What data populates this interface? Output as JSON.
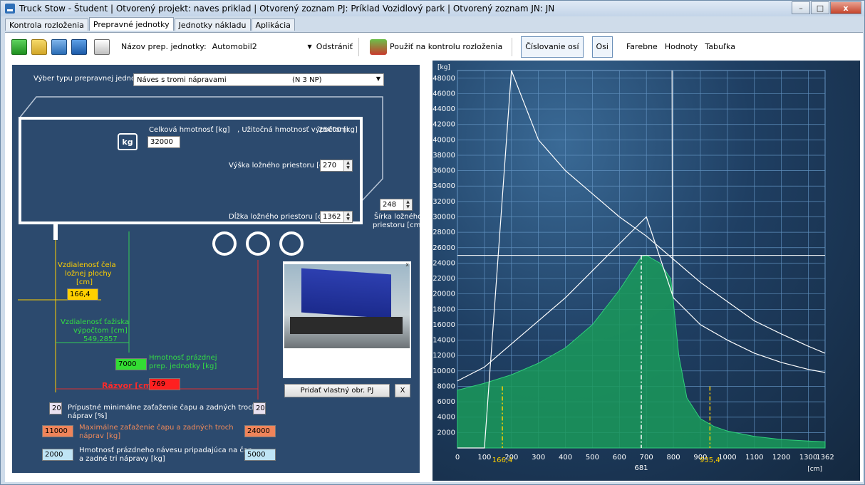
{
  "window": {
    "title": "Truck Stow - Študent  |  Otvorený projekt: naves priklad  |  Otvorený zoznam PJ: Príklad Vozidlový park  |  Otvorený zoznam JN: JN",
    "minimize": "–",
    "maximize": "□",
    "close": "x"
  },
  "tabs": [
    {
      "label": "Kontrola rozloženia",
      "active": false
    },
    {
      "label": "Prepravné jednotky",
      "active": true
    },
    {
      "label": "Jednotky nákladu",
      "active": false
    },
    {
      "label": "Aplikácia",
      "active": false
    }
  ],
  "toolbar": {
    "icons": [
      "new-icon",
      "open-folder-icon",
      "copy-icon",
      "save-icon",
      "print-icon"
    ],
    "unit_name_label": "Názov prep. jednotky:",
    "unit_name_value": "Automobil2",
    "remove_label": "Odstrániť",
    "apply_label": "Použiť na kontrolu rozloženia",
    "axle_numbering_label": "Číslovanie osí",
    "axles_label": "Osi",
    "colored_label": "Farebne",
    "values_label": "Hodnoty",
    "table_label": "Tabuľka"
  },
  "left": {
    "type_label": "Výber typu prepravnej jednotky",
    "type_value": "Náves s tromi nápravami",
    "type_code": "(N 3 NP)",
    "total_weight_label": "Celková hmotnosť [kg]",
    "payload_label": ", Užitočná hmotnosť výpočtom:",
    "payload_value": "25000 [kg]",
    "total_weight_value": "32000",
    "kg_icon_text": "kg",
    "height_label": "Výška ložného priestoru [cm]",
    "height_value": "270",
    "length_label": "Dĺžka ložného priestoru [cm]",
    "length_value": "1362",
    "width_value": "248",
    "width_label_1": "Šírka ložného",
    "width_label_2": "priestoru [cm]",
    "front_dist_label_1": "Vzdialenosť čela",
    "front_dist_label_2": "ložnej plochy",
    "front_dist_label_3": "[cm]",
    "front_dist_value": "166,4",
    "cog_label_1": "Vzdialenosť ťažiska",
    "cog_label_2": "výpočtom [cm]",
    "cog_value": "549,2857",
    "empty_weight_value": "7000",
    "empty_weight_label_1": "Hmotnosť prázdnej",
    "empty_weight_label_2": "prep. jednotky [kg]",
    "spacing_label": "Rázvor [cm]",
    "spacing_value": "769",
    "min_pct_left": "20",
    "min_pct_right": "20",
    "min_load_label_1": "Prípustné minimálne zaťaženie čapu a zadných troch",
    "min_load_label_2": "náprav [%]",
    "max_left": "11000",
    "max_right": "24000",
    "max_label_1": "Maximálne zaťaženie čapu a zadných troch",
    "max_label_2": "náprav [kg]",
    "empty_left": "2000",
    "empty_right": "5000",
    "empty_label_1": "Hmotnosť prázdneho návesu pripadajúca na čap",
    "empty_label_2": "a zadné tri nápravy [kg]",
    "add_image_label": "Pridať vlastný obr. PJ",
    "remove_image_label": "X",
    "photo_close": "x"
  },
  "colors": {
    "panel_bg": "#2c4a6e",
    "fill_green": "#1a9a5a",
    "yellow": "#ffd000",
    "green_field": "#33dd33",
    "red_field": "#ff2020",
    "orange_field": "#f0845a",
    "blue_field": "#bfe4f5"
  },
  "chart_data": {
    "type": "area",
    "ylabel": "[kg]",
    "xlabel": "[cm]",
    "xlim": [
      0,
      1362
    ],
    "ylim": [
      0,
      49000
    ],
    "x_ticks": [
      0,
      100,
      200,
      300,
      400,
      500,
      600,
      700,
      800,
      900,
      1000,
      1100,
      1200,
      1300,
      1362
    ],
    "y_ticks": [
      2000,
      4000,
      6000,
      8000,
      10000,
      12000,
      14000,
      16000,
      18000,
      20000,
      22000,
      24000,
      26000,
      28000,
      30000,
      32000,
      34000,
      36000,
      38000,
      40000,
      42000,
      44000,
      46000,
      48000
    ],
    "vertical_markers": [
      166.4,
      681,
      935.4
    ],
    "vertical_marker_labels": [
      "166,4",
      "681",
      "935,4"
    ],
    "horizontal_line": 25000,
    "grid": true,
    "series": [
      {
        "x": [
          0,
          100,
          200,
          300,
          400,
          500,
          600,
          681,
          700,
          750,
          790,
          800,
          820,
          850,
          900,
          950,
          1000,
          1100,
          1200,
          1300,
          1362
        ],
        "y": [
          7500,
          8400,
          9500,
          11000,
          13000,
          16000,
          20500,
          24800,
          25000,
          24000,
          22000,
          19000,
          12000,
          6500,
          3800,
          2800,
          2200,
          1500,
          1100,
          900,
          800
        ]
      }
    ],
    "curves": [
      {
        "x": [
          0,
          100,
          200,
          300,
          400,
          500,
          600,
          700,
          800,
          900,
          1000,
          1100,
          1200,
          1300,
          1362
        ],
        "y": [
          8700,
          10500,
          13500,
          16500,
          19500,
          23000,
          26500,
          30000,
          19500,
          16000,
          14000,
          12300,
          11100,
          10200,
          9800
        ]
      },
      {
        "x": [
          0,
          100,
          200,
          300,
          400,
          500,
          600,
          700,
          800,
          900,
          1000,
          1100,
          1200,
          1300,
          1362
        ],
        "y": [
          0,
          0,
          49000,
          40000,
          36000,
          33000,
          30000,
          27500,
          24500,
          21500,
          19000,
          16500,
          14800,
          13200,
          12300
        ]
      },
      {
        "x": [
          795,
          796,
          797,
          798
        ],
        "y": [
          49000,
          30000,
          25000,
          20000
        ]
      }
    ]
  }
}
